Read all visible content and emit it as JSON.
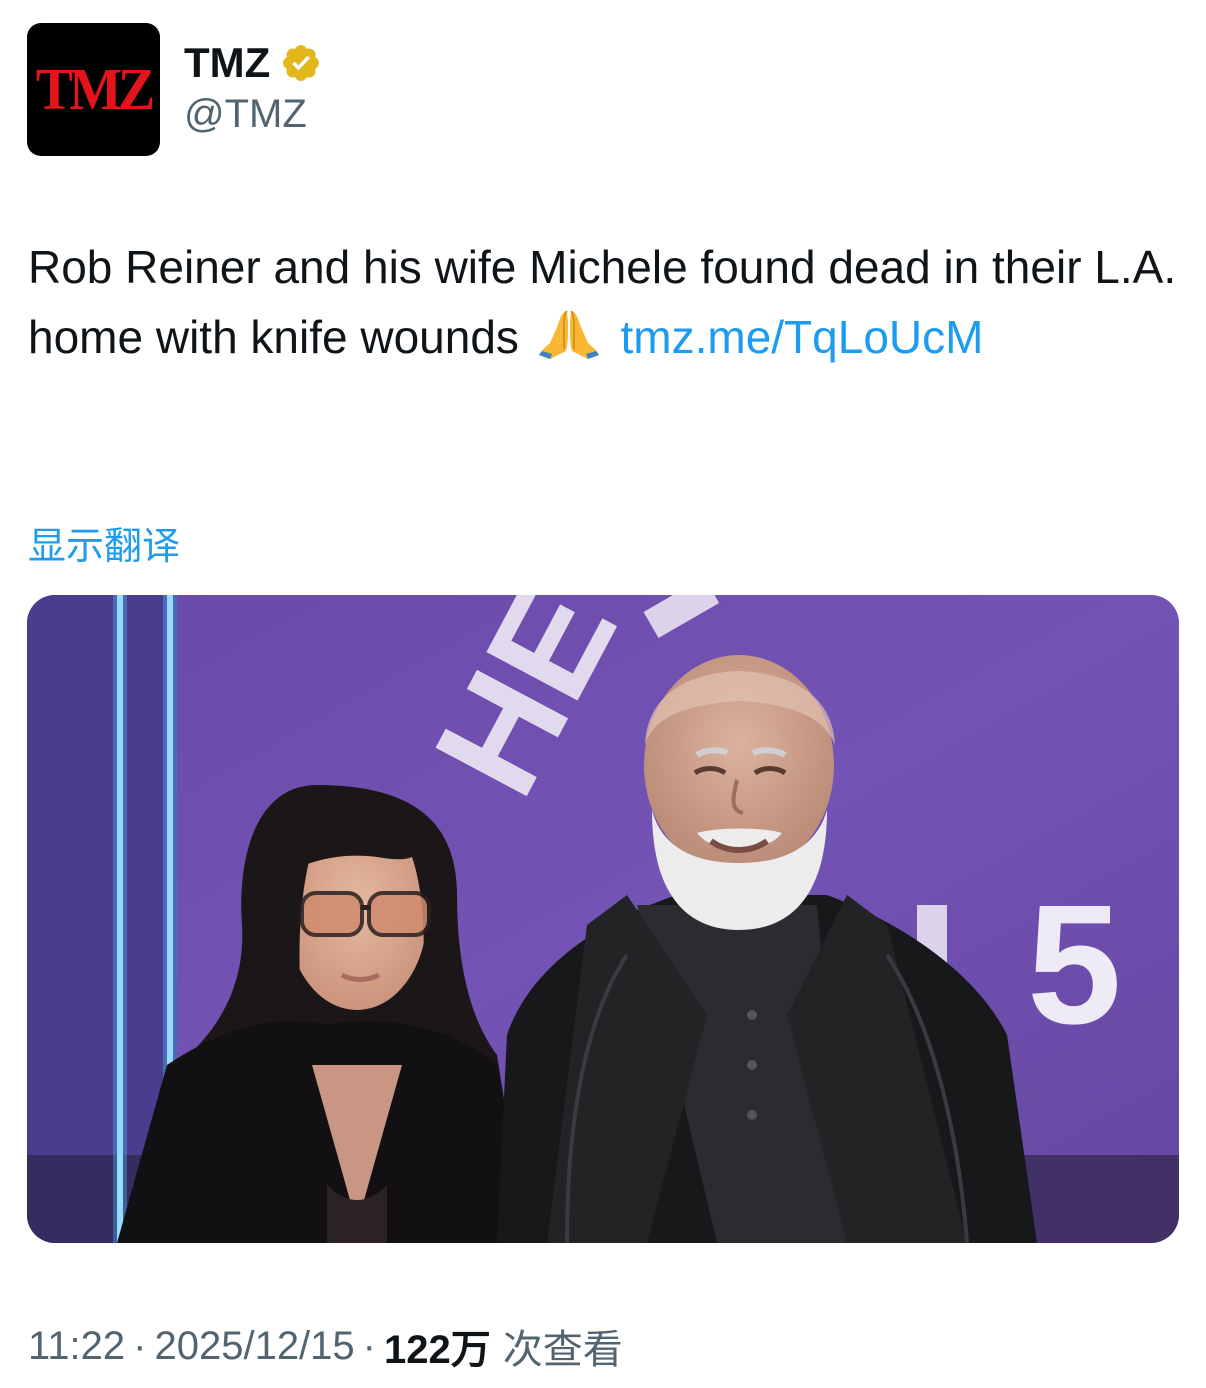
{
  "account": {
    "avatar_text": "TMZ",
    "display_name": "TMZ",
    "handle": "@TMZ",
    "verified_icon": "gold-verified-badge",
    "verified_color": "#e2b719"
  },
  "tweet": {
    "text": "Rob Reiner and his wife Michele found dead in their L.A. home with knife wounds",
    "emoji": "🙏",
    "link_text": "tmz.me/TqLoUcM",
    "link_color": "#1d9bf0",
    "translate_label": "显示翻译",
    "image_text": {
      "left_letters": "HE",
      "right_digits": "5"
    }
  },
  "meta": {
    "time": "11:22",
    "separator": "·",
    "date": "2025/12/15",
    "views_count": "122万",
    "views_label": "次查看"
  }
}
